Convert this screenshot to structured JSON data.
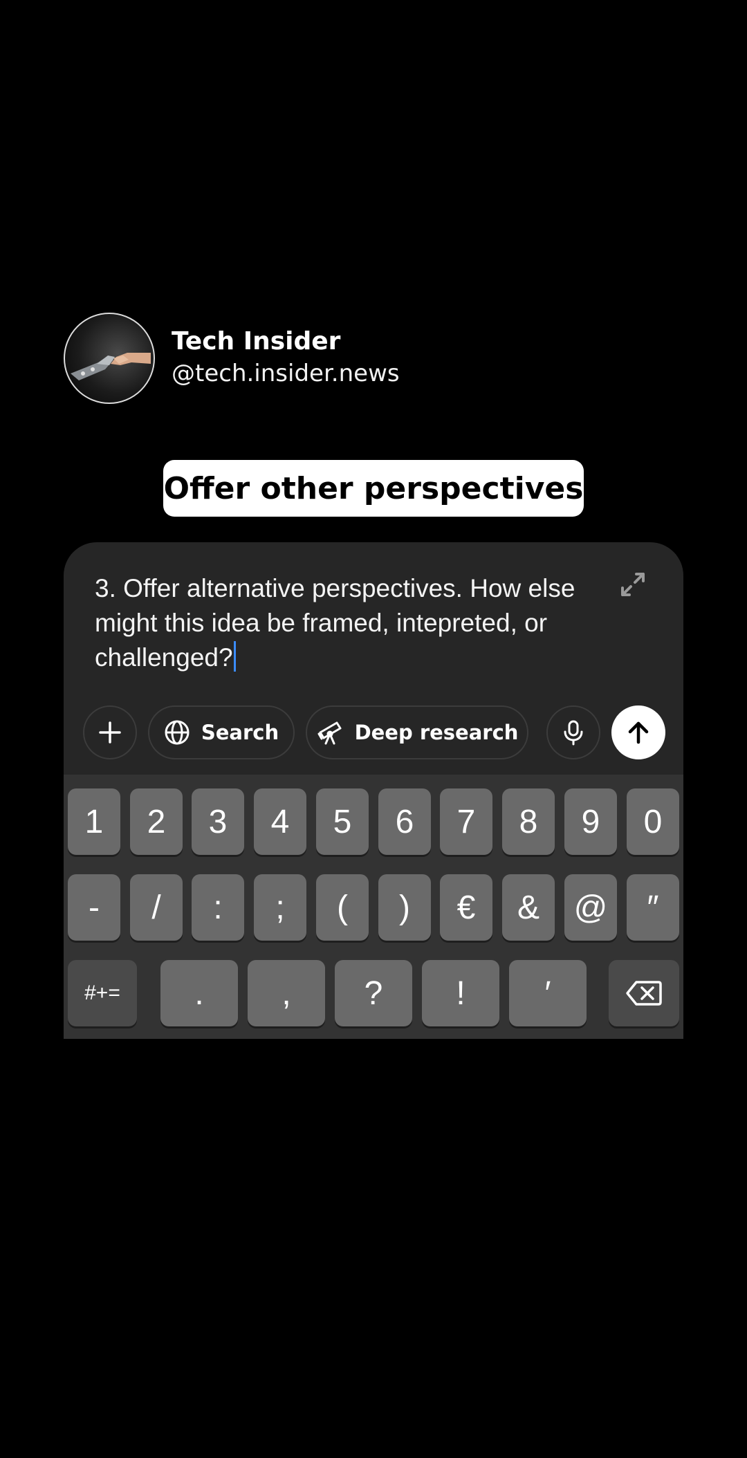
{
  "profile": {
    "name": "Tech Insider",
    "handle": "@tech.insider.news",
    "avatar_icon": "robot-human-handshake-icon"
  },
  "caption": "Offer other perspectives",
  "composer": {
    "prompt_text": "3. Offer alternative perspectives. How else might this idea be framed, intepreted, or challenged?",
    "expand_icon": "expand-arrows-icon",
    "tools": {
      "add_icon": "plus-icon",
      "search_label": "Search",
      "search_icon": "globe-icon",
      "deep_research_label": "Deep research",
      "deep_research_icon": "telescope-icon",
      "mic_icon": "microphone-icon",
      "send_icon": "arrow-up-icon"
    },
    "accent_color": "#3b8cff"
  },
  "keyboard": {
    "row1": [
      "1",
      "2",
      "3",
      "4",
      "5",
      "6",
      "7",
      "8",
      "9",
      "0"
    ],
    "row2": [
      "-",
      "/",
      ":",
      ";",
      "(",
      ")",
      "€",
      "&",
      "@",
      "″"
    ],
    "row3": {
      "symbols_toggle": "#+=",
      "keys": [
        ".",
        ",",
        "?",
        "!",
        "′"
      ],
      "backspace_icon": "backspace-icon"
    }
  }
}
